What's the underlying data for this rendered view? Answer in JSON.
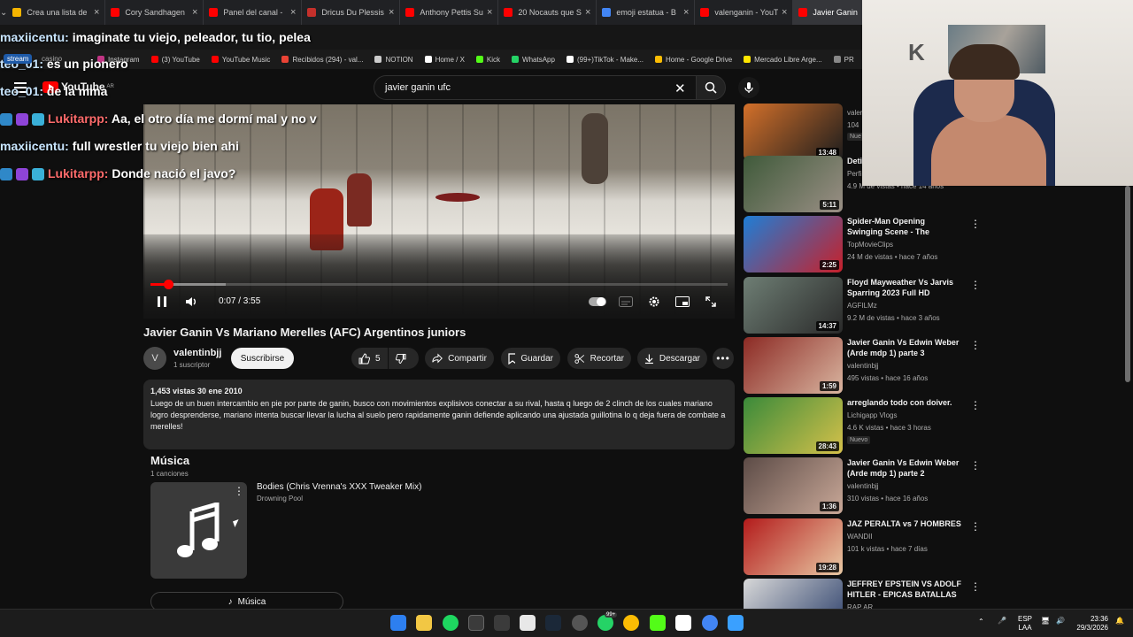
{
  "browser": {
    "tabs": [
      {
        "title": "Crea una lista de",
        "color": "#f4b400"
      },
      {
        "title": "Cory Sandhagen",
        "color": "#ff0000"
      },
      {
        "title": "Panel del canal -",
        "color": "#ff0000"
      },
      {
        "title": "Dricus Du Plessis",
        "color": "#c4302b"
      },
      {
        "title": "Anthony Pettis Su",
        "color": "#ff0000"
      },
      {
        "title": "20 Nocauts que S",
        "color": "#ff0000"
      },
      {
        "title": "emoji estatua - B",
        "color": "#4285f4"
      },
      {
        "title": "valenganin - YouT",
        "color": "#ff0000"
      },
      {
        "title": "Javier Ganin",
        "color": "#ff0000"
      }
    ],
    "bookmarks": [
      {
        "label": "Instagram",
        "color": "#c13584"
      },
      {
        "label": "(3) YouTube",
        "color": "#ff0000"
      },
      {
        "label": "YouTube Music",
        "color": "#ff0000"
      },
      {
        "label": "Recibidos (294) - val...",
        "color": "#ea4335"
      },
      {
        "label": "NOTION",
        "color": "#cccccc"
      },
      {
        "label": "Home / X",
        "color": "#ffffff"
      },
      {
        "label": "Kick",
        "color": "#53fc18"
      },
      {
        "label": "WhatsApp",
        "color": "#25d366"
      },
      {
        "label": "(99+)TikTok - Make...",
        "color": "#ffffff"
      },
      {
        "label": "Home - Google Drive",
        "color": "#fbbc04"
      },
      {
        "label": "Mercado Libre Arge...",
        "color": "#ffe600"
      },
      {
        "label": "PR",
        "color": "#888888"
      }
    ]
  },
  "overlay": {
    "stream_label": "stream",
    "casino_label": "casino",
    "messages": [
      {
        "user": "maxiicentu:",
        "text": "imaginate tu viejo, peleador, tu tio, pelea"
      },
      {
        "user": "teo_01:",
        "text": "es un pionero"
      },
      {
        "user": "teo_01:",
        "text": "de la mma"
      },
      {
        "user": "Lukitarpp:",
        "text": "Aa, el otro día me dormí mal y no v"
      },
      {
        "user": "maxiicentu:",
        "text": "full wrestler tu viejo bien ahi"
      },
      {
        "user": "Lukitarpp:",
        "text": "Donde nació el javo?"
      }
    ]
  },
  "youtube": {
    "logo": "YouTube",
    "region": "AR",
    "search_query": "javier ganin ufc",
    "player": {
      "time": "0:07 / 3:55",
      "progress": 0.03,
      "buffered": 0.13
    },
    "video_title": "Javier Ganin Vs Mariano Merelles (AFC) Argentinos juniors",
    "channel": {
      "initial": "V",
      "name": "valentinbjj",
      "subs": "1 suscriptor"
    },
    "subscribe_label": "Suscribirse",
    "actions": {
      "likes": "5",
      "share": "Compartir",
      "save": "Guardar",
      "clip": "Recortar",
      "download": "Descargar"
    },
    "description": {
      "meta": "1,453 vistas  30 ene 2010",
      "text": "Luego de un buen intercambio en pie por parte de ganin, busco con movimientos explisivos conectar a su rival, hasta q luego de 2 clinch de los cuales mariano logro desprenderse, mariano intenta buscar llevar la lucha al suelo pero rapidamente ganin defiende aplicando una ajustada guillotina lo q deja fuera de combate a merelles!"
    },
    "music": {
      "heading": "Música",
      "count": "1 canciones",
      "song": "Bodies (Chris Vrenna's XXX Tweaker Mix)",
      "artist": "Drowning Pool",
      "button": "Música"
    },
    "related": [
      {
        "title": "",
        "channel": "valer",
        "stats": "104",
        "badge": "Nue",
        "duration": "13:48",
        "colors": [
          "#d3702a",
          "#1d1d1d"
        ]
      },
      {
        "title": "Deti dosi",
        "channel": "Perfi",
        "stats": "4.9 M de vistas • hace 14 años",
        "badge": "",
        "duration": "5:11",
        "colors": [
          "#3f5a3a",
          "#9a8f85"
        ]
      },
      {
        "title": "Spider-Man Opening Swinging Scene - The Amazing Spider-...",
        "channel": "TopMovieClips",
        "stats": "24 M de vistas • hace 7 años",
        "badge": "",
        "duration": "2:25",
        "colors": [
          "#1e7ed6",
          "#c8202a"
        ]
      },
      {
        "title": "Floyd Mayweather Vs Jarvis Sparring 2023 Full HD",
        "channel": "AGFILMz",
        "stats": "9.2 M de vistas • hace 3 años",
        "badge": "",
        "duration": "14:37",
        "colors": [
          "#6e7e74",
          "#2a2a2a"
        ]
      },
      {
        "title": "Javier Ganin Vs Edwin Weber (Arde mdp 1) parte 3",
        "channel": "valentinbjj",
        "stats": "495 vistas • hace 16 años",
        "badge": "",
        "duration": "1:59",
        "colors": [
          "#8c2a24",
          "#d9b5a0"
        ]
      },
      {
        "title": "arreglando todo con doiver.",
        "channel": "Lichigapp Vlogs",
        "stats": "4.6 K vistas • hace 3 horas",
        "badge": "Nuevo",
        "duration": "28:43",
        "colors": [
          "#3a8a3a",
          "#d5c14a"
        ]
      },
      {
        "title": "Javier Ganin Vs Edwin Weber (Arde mdp 1) parte 2",
        "channel": "valentinbjj",
        "stats": "310 vistas • hace 16 años",
        "badge": "",
        "duration": "1:36",
        "colors": [
          "#5c4b46",
          "#c9a898"
        ]
      },
      {
        "title": "JAZ PERALTA vs 7 HOMBRES",
        "channel": "WANDII",
        "stats": "101 k vistas • hace 7 días",
        "badge": "",
        "duration": "19:28",
        "colors": [
          "#b31b1b",
          "#e9c9a4"
        ]
      },
      {
        "title": "JEFFREY EPSTEIN VS ADOLF HITLER - EPICAS BATALLAS D...",
        "channel": "RAP AR",
        "stats": "",
        "badge": "",
        "duration": "",
        "colors": [
          "#d8d8d8",
          "#2a3e6a"
        ]
      }
    ]
  },
  "taskbar": {
    "lang": "ESP",
    "lang2": "LAA",
    "time": "23:36",
    "date": "29/3/2026",
    "whatsapp_badge": "99+"
  }
}
